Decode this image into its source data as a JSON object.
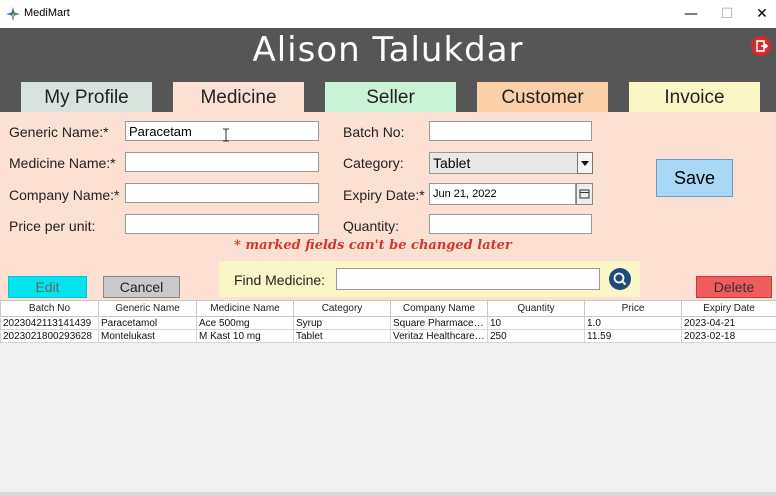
{
  "window": {
    "title": "MediMart",
    "minimize": "—",
    "maximize": "☐",
    "close": "✕"
  },
  "header": {
    "user_name": "Alison Talukdar"
  },
  "tabs": [
    {
      "label": "My Profile",
      "color": "#d7e3dc"
    },
    {
      "label": "Medicine",
      "color": "#fce0d4"
    },
    {
      "label": "Seller",
      "color": "#c9f3d6"
    },
    {
      "label": "Customer",
      "color": "#fbd0a8"
    },
    {
      "label": "Invoice",
      "color": "#fbf6c6"
    }
  ],
  "form": {
    "generic_name": {
      "label": "Generic Name:*",
      "value": "Paracetam"
    },
    "medicine_name": {
      "label": "Medicine Name:*",
      "value": ""
    },
    "company_name": {
      "label": "Company Name:*",
      "value": ""
    },
    "price_per_unit": {
      "label": "Price per unit:",
      "value": ""
    },
    "batch_no": {
      "label": "Batch No:",
      "value": ""
    },
    "category": {
      "label": "Category:",
      "value": "Tablet"
    },
    "expiry_date": {
      "label": "Expiry Date:*",
      "value": "Jun 21, 2022"
    },
    "quantity": {
      "label": "Quantity:",
      "value": ""
    },
    "note": "* marked fields can't be changed later"
  },
  "buttons": {
    "save": "Save",
    "edit": "Edit",
    "cancel": "Cancel",
    "delete": "Delete"
  },
  "find": {
    "label": "Find Medicine:",
    "value": ""
  },
  "table": {
    "columns": [
      "Batch No",
      "Generic Name",
      "Medicine Name",
      "Category",
      "Company Name",
      "Quantity",
      "Price",
      "Expiry Date"
    ],
    "rows": [
      [
        "2023042113141439",
        "Paracetamol",
        "Ace 500mg",
        "Syrup",
        "Square Pharmaceuti...",
        "10",
        "1.0",
        "2023-04-21"
      ],
      [
        "2023021800293628",
        "Montelukast",
        "M Kast 10 mg",
        "Tablet",
        "Veritaz Healthcare Ltd",
        "250",
        "11.59",
        "2023-02-18"
      ]
    ]
  },
  "colors": {
    "header_bg": "#565656",
    "panel_bg": "#fce0d4",
    "save_bg": "#a8d8f5",
    "edit_bg": "#00e5ee",
    "cancel_bg": "#c9c9c9",
    "delete_bg": "#f05b5b"
  }
}
